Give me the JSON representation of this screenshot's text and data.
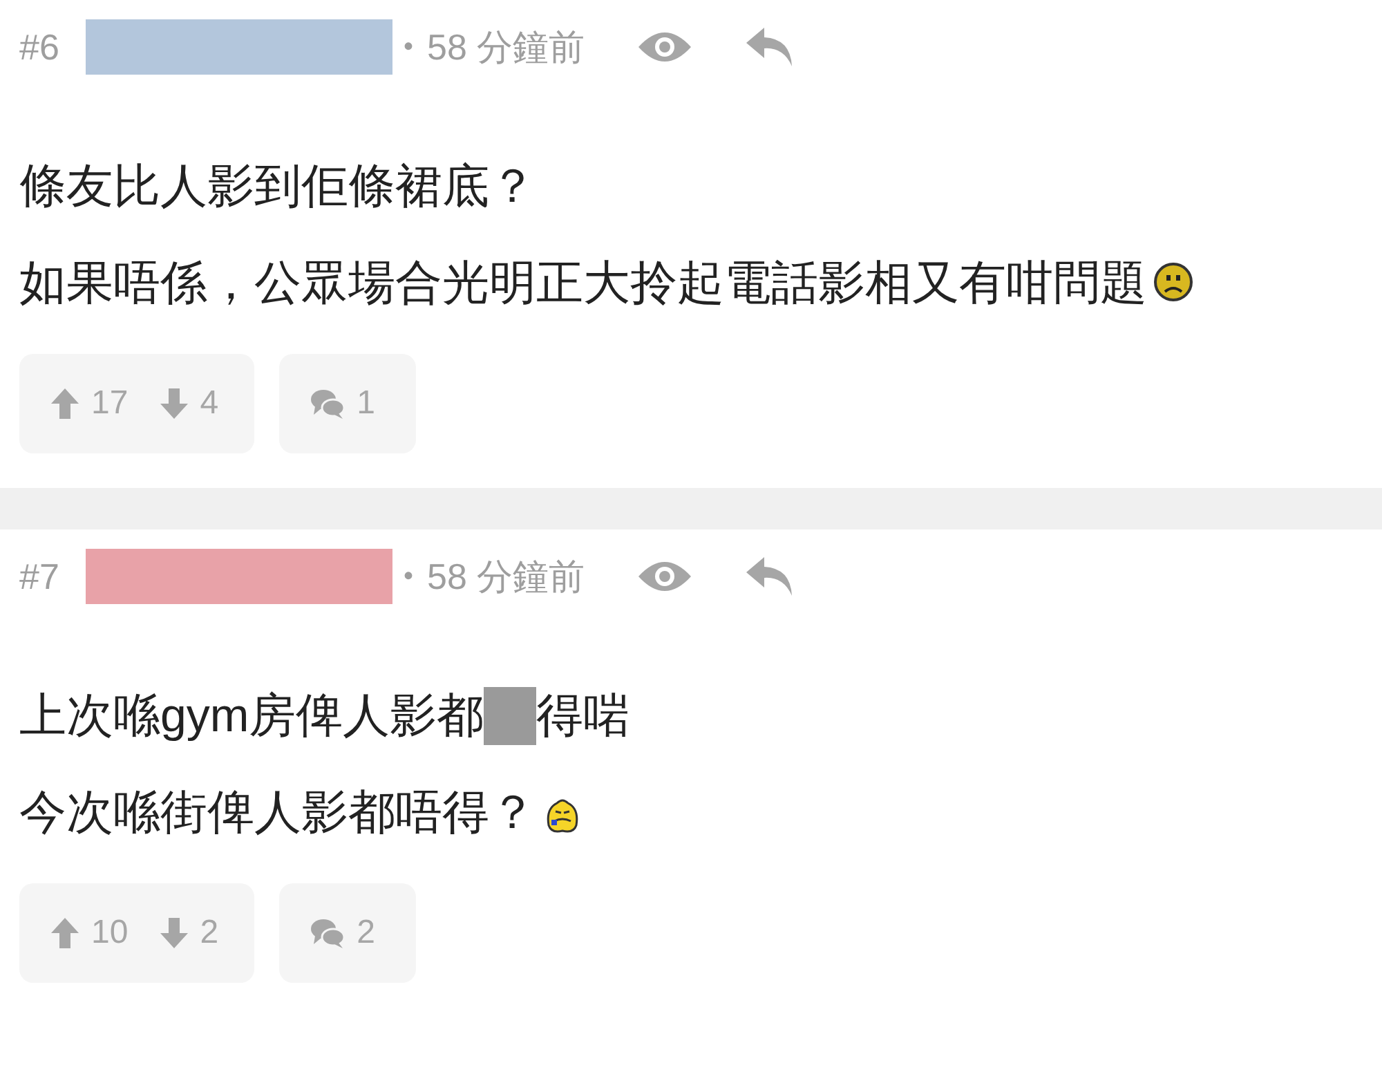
{
  "posts": [
    {
      "number": "#6",
      "color": "#b3c6dc",
      "separator": "•",
      "time": "58 分鐘前",
      "lines": [
        [
          {
            "kind": "text",
            "text": "條友比人影到佢條裙底？"
          }
        ],
        [
          {
            "kind": "text",
            "text": "如果唔係，公眾場合光明正大拎起電話影相又有咁問題"
          },
          {
            "kind": "frown"
          }
        ]
      ],
      "upvotes": "17",
      "downvotes": "4",
      "replies": "1"
    },
    {
      "number": "#7",
      "color": "#e8a2a8",
      "separator": "•",
      "time": "58 分鐘前",
      "lines": [
        [
          {
            "kind": "text",
            "text": "上次喺gym房俾人影都"
          },
          {
            "kind": "redacted"
          },
          {
            "kind": "text",
            "text": "得啱"
          }
        ],
        [
          {
            "kind": "text",
            "text": "今次喺街俾人影都唔得？"
          },
          {
            "kind": "upset"
          }
        ]
      ],
      "upvotes": "10",
      "downvotes": "2",
      "replies": "2"
    }
  ]
}
